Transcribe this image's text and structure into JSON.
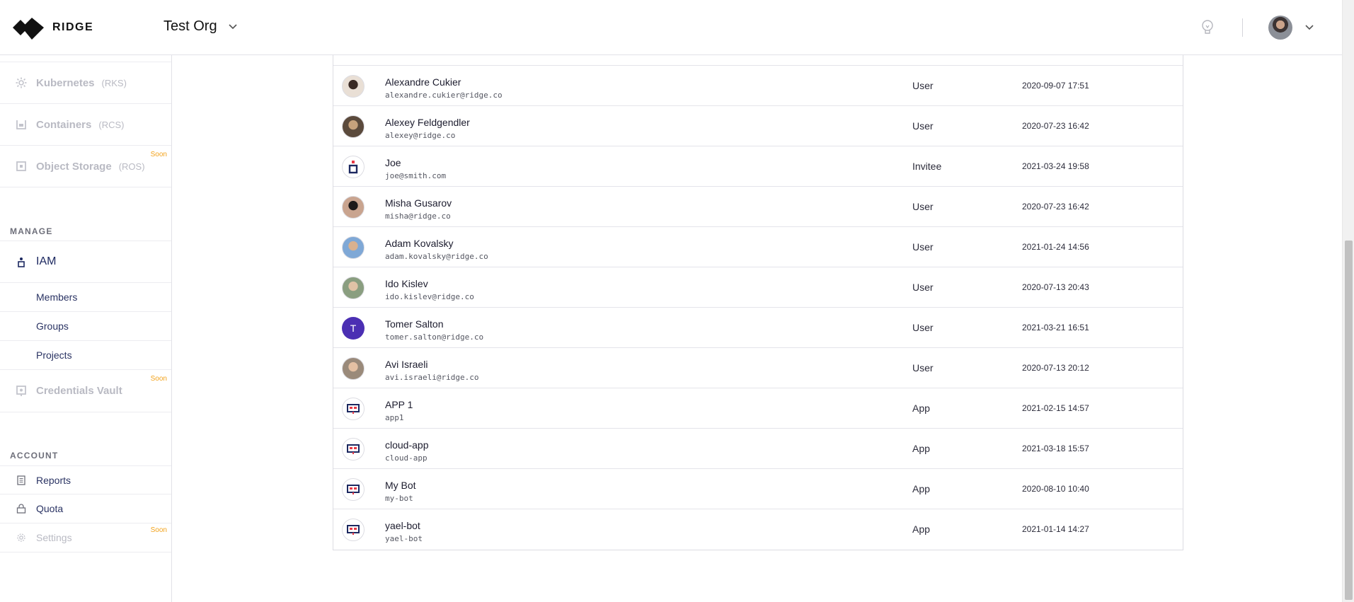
{
  "header": {
    "logo_text": "RIDGE",
    "org_name": "Test Org"
  },
  "sidebar": {
    "services": [
      {
        "label": "Kubernetes",
        "abbr": "(RKS)",
        "icon": "kubernetes-icon",
        "soon": ""
      },
      {
        "label": "Containers",
        "abbr": "(RCS)",
        "icon": "container-icon",
        "soon": ""
      },
      {
        "label": "Object Storage",
        "abbr": "(ROS)",
        "icon": "storage-icon",
        "soon": "Soon"
      }
    ],
    "manage_title": "MANAGE",
    "iam_label": "IAM",
    "iam_items": [
      {
        "label": "Members"
      },
      {
        "label": "Groups"
      },
      {
        "label": "Projects"
      }
    ],
    "vault_label": "Credentials Vault",
    "vault_soon": "Soon",
    "account_title": "ACCOUNT",
    "account_items": [
      {
        "label": "Reports",
        "icon": "document-icon",
        "soon": ""
      },
      {
        "label": "Quota",
        "icon": "lock-icon",
        "soon": ""
      },
      {
        "label": "Settings",
        "icon": "gear-icon",
        "soon": "Soon"
      }
    ]
  },
  "members": [
    {
      "name": "Alexandre Cukier",
      "email": "alexandre.cukier@ridge.co",
      "type": "User",
      "date": "2020-09-07 17:51",
      "avatar": "photo"
    },
    {
      "name": "Alexey Feldgendler",
      "email": "alexey@ridge.co",
      "type": "User",
      "date": "2020-07-23 16:42",
      "avatar": "photo"
    },
    {
      "name": "Joe",
      "email": "joe@smith.com",
      "type": "Invitee",
      "date": "2021-03-24 19:58",
      "avatar": "invitee"
    },
    {
      "name": "Misha Gusarov",
      "email": "misha@ridge.co",
      "type": "User",
      "date": "2020-07-23 16:42",
      "avatar": "photo"
    },
    {
      "name": "Adam Kovalsky",
      "email": "adam.kovalsky@ridge.co",
      "type": "User",
      "date": "2021-01-24 14:56",
      "avatar": "photo"
    },
    {
      "name": "Ido Kislev",
      "email": "ido.kislev@ridge.co",
      "type": "User",
      "date": "2020-07-13 20:43",
      "avatar": "photo"
    },
    {
      "name": "Tomer Salton",
      "email": "tomer.salton@ridge.co",
      "type": "User",
      "date": "2021-03-21 16:51",
      "avatar": "initial",
      "initial": "T"
    },
    {
      "name": "Avi Israeli",
      "email": "avi.israeli@ridge.co",
      "type": "User",
      "date": "2020-07-13 20:12",
      "avatar": "photo"
    },
    {
      "name": "APP 1",
      "email": "app1",
      "type": "App",
      "date": "2021-02-15 14:57",
      "avatar": "app"
    },
    {
      "name": "cloud-app",
      "email": "cloud-app",
      "type": "App",
      "date": "2021-03-18 15:57",
      "avatar": "app"
    },
    {
      "name": "My Bot",
      "email": "my-bot",
      "type": "App",
      "date": "2020-08-10 10:40",
      "avatar": "app"
    },
    {
      "name": "yael-bot",
      "email": "yael-bot",
      "type": "App",
      "date": "2021-01-14 14:27",
      "avatar": "app"
    }
  ],
  "colors": {
    "accent": "#1c2860",
    "soon": "#f2a21b",
    "initial_avatar": "#4b2fb3"
  }
}
